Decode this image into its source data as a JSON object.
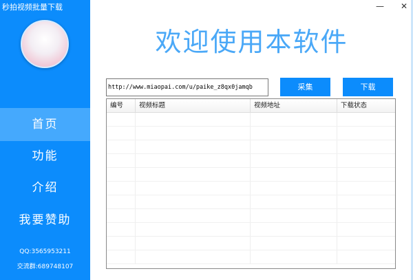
{
  "app": {
    "title": "秒拍视频批量下载",
    "minimize": "—",
    "close": "✕"
  },
  "sidebar": {
    "items": [
      {
        "label": "首页",
        "active": true
      },
      {
        "label": "功能"
      },
      {
        "label": "介绍"
      },
      {
        "label": "我要赞助"
      }
    ],
    "qq": "QQ:3565953211",
    "group": "交流群:689748107"
  },
  "main": {
    "welcome": "欢迎使用本软件",
    "url_value": "http://www.miaopai.com/u/paike_z8qx0jamqb",
    "collect_label": "采集",
    "download_label": "下载",
    "table": {
      "columns": [
        "编号",
        "视频标题",
        "视频地址",
        "下载状态"
      ],
      "rows": []
    }
  },
  "colors": {
    "accent": "#0c8cfc",
    "active": "#45a9fd"
  }
}
